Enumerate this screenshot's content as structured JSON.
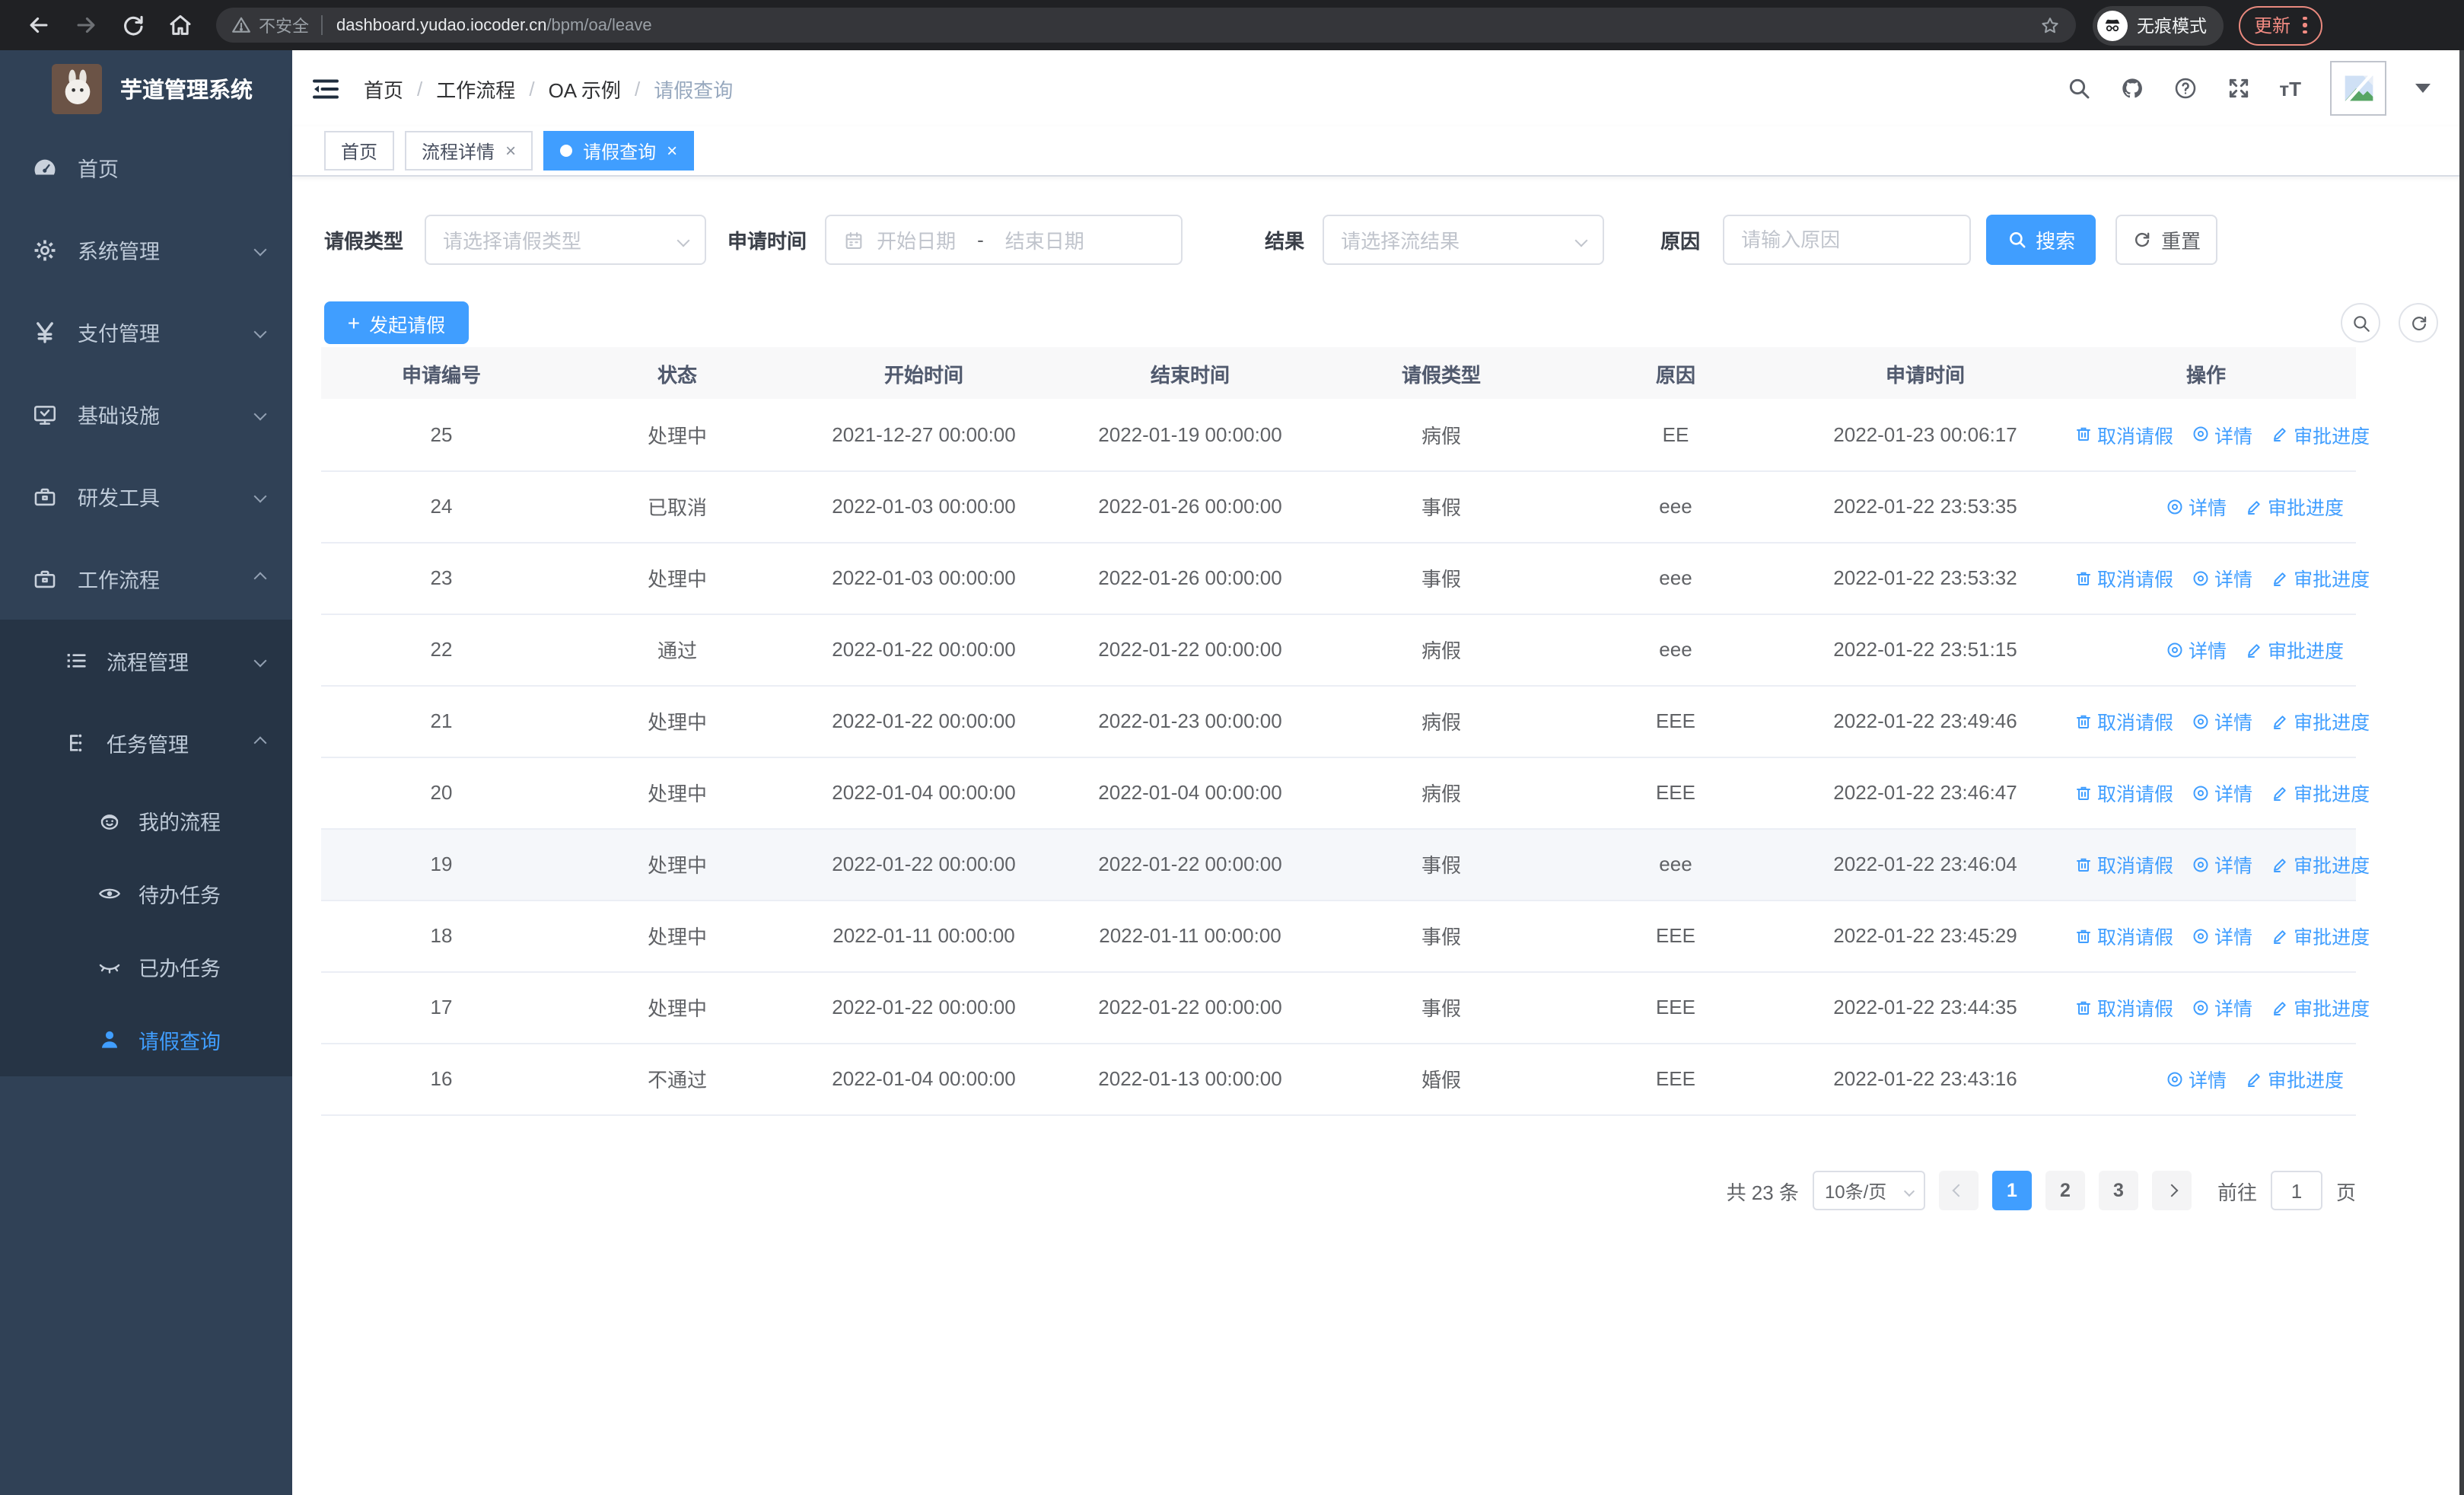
{
  "browser": {
    "security_label": "不安全",
    "url_host": "dashboard.yudao.iocoder.cn",
    "url_path": "/bpm/oa/leave",
    "incognito_label": "无痕模式",
    "update_label": "更新"
  },
  "sidebar": {
    "app_title": "芋道管理系统",
    "items": [
      {
        "label": "首页",
        "icon": "dashboard-icon"
      },
      {
        "label": "系统管理",
        "icon": "gear-icon"
      },
      {
        "label": "支付管理",
        "icon": "yen-icon"
      },
      {
        "label": "基础设施",
        "icon": "monitor-icon"
      },
      {
        "label": "研发工具",
        "icon": "toolbox-icon"
      },
      {
        "label": "工作流程",
        "icon": "briefcase-icon"
      }
    ],
    "submenu": [
      {
        "label": "流程管理",
        "icon": "list-icon"
      },
      {
        "label": "任务管理",
        "icon": "tree-icon"
      }
    ],
    "task_items": [
      {
        "label": "我的流程",
        "icon": "robot-face-icon"
      },
      {
        "label": "待办任务",
        "icon": "eye-icon"
      },
      {
        "label": "已办任务",
        "icon": "eye-closed-icon"
      },
      {
        "label": "请假查询",
        "icon": "user-icon",
        "active": true
      }
    ]
  },
  "navbar": {
    "breadcrumb": [
      "首页",
      "工作流程",
      "OA 示例",
      "请假查询"
    ]
  },
  "tabs": [
    {
      "label": "首页"
    },
    {
      "label": "流程详情"
    },
    {
      "label": "请假查询"
    }
  ],
  "filters": {
    "leave_type_label": "请假类型",
    "leave_type_placeholder": "请选择请假类型",
    "apply_time_label": "申请时间",
    "date_start_placeholder": "开始日期",
    "date_separator": "-",
    "date_end_placeholder": "结束日期",
    "result_label": "结果",
    "result_placeholder": "请选择流结果",
    "reason_label": "原因",
    "reason_placeholder": "请输入原因",
    "search_label": "搜索",
    "reset_label": "重置"
  },
  "toolbar": {
    "create_label": "发起请假"
  },
  "table": {
    "columns": [
      "申请编号",
      "状态",
      "开始时间",
      "结束时间",
      "请假类型",
      "原因",
      "申请时间",
      "操作"
    ],
    "action_labels": {
      "cancel": "取消请假",
      "detail": "详情",
      "progress": "审批进度"
    },
    "rows": [
      {
        "id": "25",
        "status": "处理中",
        "start": "2021-12-27 00:00:00",
        "end": "2022-01-19 00:00:00",
        "type": "病假",
        "reason": "EE",
        "applied": "2022-01-23 00:06:17",
        "actions": [
          "cancel",
          "detail",
          "progress"
        ]
      },
      {
        "id": "24",
        "status": "已取消",
        "start": "2022-01-03 00:00:00",
        "end": "2022-01-26 00:00:00",
        "type": "事假",
        "reason": "eee",
        "applied": "2022-01-22 23:53:35",
        "actions": [
          "detail",
          "progress"
        ]
      },
      {
        "id": "23",
        "status": "处理中",
        "start": "2022-01-03 00:00:00",
        "end": "2022-01-26 00:00:00",
        "type": "事假",
        "reason": "eee",
        "applied": "2022-01-22 23:53:32",
        "actions": [
          "cancel",
          "detail",
          "progress"
        ]
      },
      {
        "id": "22",
        "status": "通过",
        "start": "2022-01-22 00:00:00",
        "end": "2022-01-22 00:00:00",
        "type": "病假",
        "reason": "eee",
        "applied": "2022-01-22 23:51:15",
        "actions": [
          "detail",
          "progress"
        ]
      },
      {
        "id": "21",
        "status": "处理中",
        "start": "2022-01-22 00:00:00",
        "end": "2022-01-23 00:00:00",
        "type": "病假",
        "reason": "EEE",
        "applied": "2022-01-22 23:49:46",
        "actions": [
          "cancel",
          "detail",
          "progress"
        ]
      },
      {
        "id": "20",
        "status": "处理中",
        "start": "2022-01-04 00:00:00",
        "end": "2022-01-04 00:00:00",
        "type": "病假",
        "reason": "EEE",
        "applied": "2022-01-22 23:46:47",
        "actions": [
          "cancel",
          "detail",
          "progress"
        ]
      },
      {
        "id": "19",
        "status": "处理中",
        "start": "2022-01-22 00:00:00",
        "end": "2022-01-22 00:00:00",
        "type": "事假",
        "reason": "eee",
        "applied": "2022-01-22 23:46:04",
        "actions": [
          "cancel",
          "detail",
          "progress"
        ],
        "highlight": true
      },
      {
        "id": "18",
        "status": "处理中",
        "start": "2022-01-11 00:00:00",
        "end": "2022-01-11 00:00:00",
        "type": "事假",
        "reason": "EEE",
        "applied": "2022-01-22 23:45:29",
        "actions": [
          "cancel",
          "detail",
          "progress"
        ]
      },
      {
        "id": "17",
        "status": "处理中",
        "start": "2022-01-22 00:00:00",
        "end": "2022-01-22 00:00:00",
        "type": "事假",
        "reason": "EEE",
        "applied": "2022-01-22 23:44:35",
        "actions": [
          "cancel",
          "detail",
          "progress"
        ]
      },
      {
        "id": "16",
        "status": "不通过",
        "start": "2022-01-04 00:00:00",
        "end": "2022-01-13 00:00:00",
        "type": "婚假",
        "reason": "EEE",
        "applied": "2022-01-22 23:43:16",
        "actions": [
          "detail",
          "progress"
        ]
      }
    ]
  },
  "pagination": {
    "total_label": "共 23 条",
    "page_size": "10条/页",
    "pages": [
      "1",
      "2",
      "3"
    ],
    "active_page": "1",
    "goto_label": "前往",
    "goto_value": "1",
    "goto_suffix": "页"
  },
  "colors": {
    "primary": "#409eff",
    "sidebar_bg": "#304156",
    "sidebar_sub_bg": "#263445"
  }
}
